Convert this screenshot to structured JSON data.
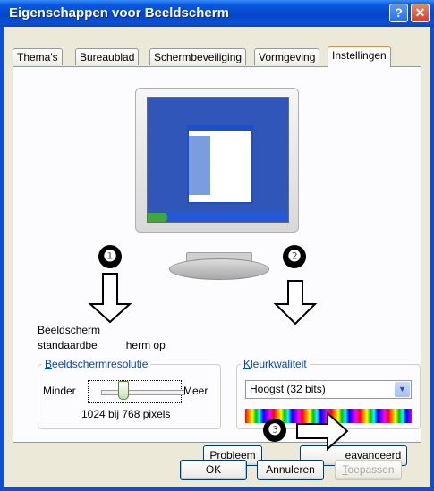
{
  "window": {
    "title": "Eigenschappen voor Beeldscherm",
    "help_glyph": "?",
    "close_glyph": "✕"
  },
  "tabs": [
    {
      "label": "Thema's"
    },
    {
      "label": "Bureaublad"
    },
    {
      "label": "Schermbeveiliging"
    },
    {
      "label": "Vormgeving"
    },
    {
      "label": "Instellingen",
      "active": true
    }
  ],
  "description": {
    "line1": "Beeldscherm",
    "line2": "standaardbe",
    "line2_tail": "herm op"
  },
  "resolution": {
    "legend_prefix": "B",
    "legend_rest": "eeldschermresolutie",
    "less": "Minder",
    "more": "Meer",
    "value_text": "1024 bij 768 pixels",
    "slider_fraction": 0.4
  },
  "color_quality": {
    "legend_prefix": "K",
    "legend_rest": "leurkwaliteit",
    "selected": "Hoogst (32 bits)"
  },
  "buttons": {
    "troubleshoot_prefix": "P",
    "troubleshoot_rest": "robleem",
    "advanced_rest": "eavanceerd",
    "ok": "OK",
    "cancel": "Annuleren",
    "apply_prefix": "T",
    "apply_rest": "oepassen"
  },
  "annotations": {
    "marker1": "❶",
    "marker2": "❷",
    "marker3": "❸"
  },
  "colors": {
    "title_bar": "#0a4fd6",
    "dialog_bg": "#ece9d8",
    "legend_text": "#0046d5",
    "active_tab_highlight": "#e68b2c"
  }
}
